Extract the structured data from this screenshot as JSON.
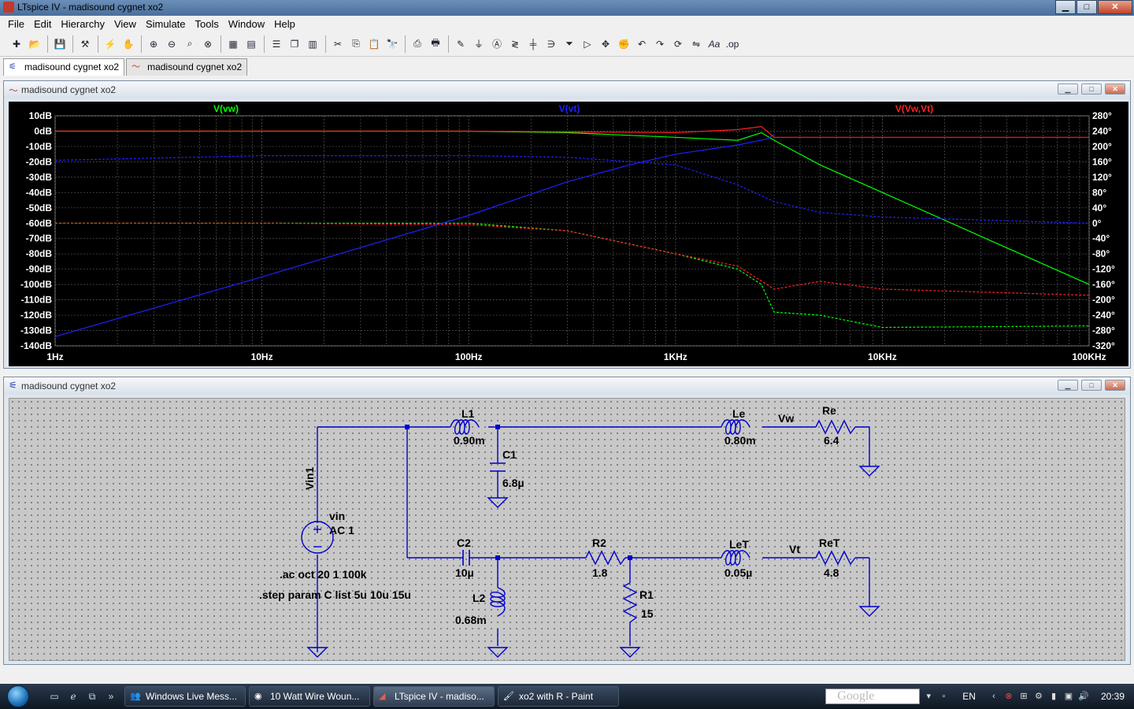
{
  "window": {
    "title": "LTspice IV - madisound cygnet xo2",
    "minimize": "▁",
    "maximize": "□",
    "close": "✕"
  },
  "menu": [
    "File",
    "Edit",
    "Hierarchy",
    "View",
    "Simulate",
    "Tools",
    "Window",
    "Help"
  ],
  "toolbar_icons": [
    "new-schematic-icon",
    "open-icon",
    "save-icon",
    "control-panel-icon",
    "run-icon",
    "halt-icon",
    "zoom-in-icon",
    "zoom-out-icon",
    "zoom-area-icon",
    "zoom-fit-icon",
    "autoscale-icon",
    "grid-icon",
    "tile-horizontal-icon",
    "cascade-icon",
    "tile-vertical-icon",
    "cut-icon",
    "copy-icon",
    "paste-icon",
    "find-icon",
    "print-icon",
    "print-preview-icon",
    "wire-icon",
    "ground-icon",
    "label-icon",
    "resistor-icon",
    "capacitor-icon",
    "inductor-icon",
    "diode-icon",
    "component-icon",
    "move-icon",
    "drag-icon",
    "undo-icon",
    "redo-icon",
    "rotate-icon",
    "mirror-icon",
    "text-icon",
    "spice-directive-icon"
  ],
  "tabs": [
    {
      "label": "madisound cygnet xo2",
      "icon": "schematic-icon"
    },
    {
      "label": "madisound cygnet xo2",
      "icon": "waveform-icon"
    }
  ],
  "waveform_window": {
    "title": "madisound cygnet xo2"
  },
  "schematic_window": {
    "title": "madisound cygnet xo2"
  },
  "chart_data": {
    "type": "line",
    "xscale": "log",
    "x_ticks": [
      "1Hz",
      "10Hz",
      "100Hz",
      "1KHz",
      "10KHz",
      "100KHz"
    ],
    "y_left_ticks": [
      "10dB",
      "0dB",
      "-10dB",
      "-20dB",
      "-30dB",
      "-40dB",
      "-50dB",
      "-60dB",
      "-70dB",
      "-80dB",
      "-90dB",
      "-100dB",
      "-110dB",
      "-120dB",
      "-130dB",
      "-140dB"
    ],
    "y_right_ticks": [
      "280°",
      "240°",
      "200°",
      "160°",
      "120°",
      "80°",
      "40°",
      "0°",
      "-40°",
      "-80°",
      "-120°",
      "-160°",
      "-200°",
      "-240°",
      "-280°",
      "-320°"
    ],
    "ylim_db": [
      -140,
      10
    ],
    "ylim_deg": [
      -320,
      280
    ],
    "xlim": [
      1,
      100000
    ],
    "grid": true,
    "trace_labels": [
      {
        "name": "V(vw)",
        "color": "#00ff00"
      },
      {
        "name": "V(vt)",
        "color": "#2020ff"
      },
      {
        "name": "V(Vw,Vt)",
        "color": "#ff2020"
      }
    ],
    "series": [
      {
        "color": "#00ff00",
        "dash": false,
        "x": [
          1,
          10,
          100,
          300,
          1000,
          2000,
          2600,
          3000,
          5000,
          10000,
          100000
        ],
        "y": [
          0,
          0,
          0,
          -1,
          -4,
          -6,
          -1,
          -6,
          -22,
          -40,
          -100
        ]
      },
      {
        "color": "#00ff00",
        "dash": true,
        "x": [
          1,
          10,
          100,
          300,
          1000,
          2000,
          2600,
          3000,
          5000,
          10000,
          100000
        ],
        "y": [
          -60,
          -60,
          -60,
          -65,
          -80,
          -90,
          -100,
          -118,
          -120,
          -128,
          -127
        ]
      },
      {
        "color": "#2020ff",
        "dash": false,
        "x": [
          1,
          10,
          100,
          300,
          600,
          1000,
          2000,
          2800,
          3000
        ],
        "y": [
          -134,
          -95,
          -55,
          -33,
          -22,
          -15,
          -9,
          -5,
          -2
        ]
      },
      {
        "color": "#2020ff",
        "dash": true,
        "x": [
          1,
          10,
          100,
          300,
          1000,
          2000,
          3000,
          5000,
          10000,
          100000
        ],
        "y": [
          -19,
          -16,
          -16,
          -17,
          -22,
          -35,
          -46,
          -53,
          -56,
          -60
        ]
      },
      {
        "color": "#ff2020",
        "dash": false,
        "x": [
          1,
          10,
          100,
          1000,
          2000,
          2600,
          3000,
          5000,
          100000
        ],
        "y": [
          0,
          0,
          0,
          -1,
          1,
          3,
          -4,
          -4,
          -4
        ]
      },
      {
        "color": "#ff2020",
        "dash": true,
        "x": [
          1,
          10,
          100,
          300,
          1000,
          2000,
          3000,
          5000,
          10000,
          100000
        ],
        "y": [
          -60,
          -60,
          -61,
          -65,
          -80,
          -88,
          -103,
          -98,
          -103,
          -107
        ]
      }
    ]
  },
  "schematic": {
    "components": [
      {
        "ref": "L1",
        "value": "0.90m"
      },
      {
        "ref": "C1",
        "value": "6.8µ"
      },
      {
        "ref": "Le",
        "value": "0.80m"
      },
      {
        "ref": "Re",
        "value": "6.4"
      },
      {
        "ref": "C2",
        "value": "10µ"
      },
      {
        "ref": "L2",
        "value": "0.68m"
      },
      {
        "ref": "R2",
        "value": "1.8"
      },
      {
        "ref": "R1",
        "value": "15"
      },
      {
        "ref": "LeT",
        "value": "0.05µ"
      },
      {
        "ref": "ReT",
        "value": "4.8"
      }
    ],
    "net_labels": {
      "vw": "Vw",
      "vt": "Vt",
      "vin": "Vin1"
    },
    "source": {
      "ref": "vin",
      "value": "AC 1"
    },
    "directives": [
      ".ac oct 20 1 100k",
      ".step param C list 5u 10u 15u"
    ]
  },
  "taskbar": {
    "quick_launch": [
      "show-desktop-icon",
      "ie-icon",
      "switch-windows-icon",
      "more-icon"
    ],
    "buttons": [
      {
        "label": "Windows Live Mess...",
        "icon": "messenger-icon"
      },
      {
        "label": "10 Watt Wire Woun...",
        "icon": "chrome-icon"
      },
      {
        "label": "LTspice IV - madiso...",
        "icon": "ltspice-icon"
      },
      {
        "label": "xo2 with R - Paint",
        "icon": "paint-icon"
      }
    ],
    "search_placeholder": "Google",
    "lang": "EN",
    "clock": "20:39"
  }
}
